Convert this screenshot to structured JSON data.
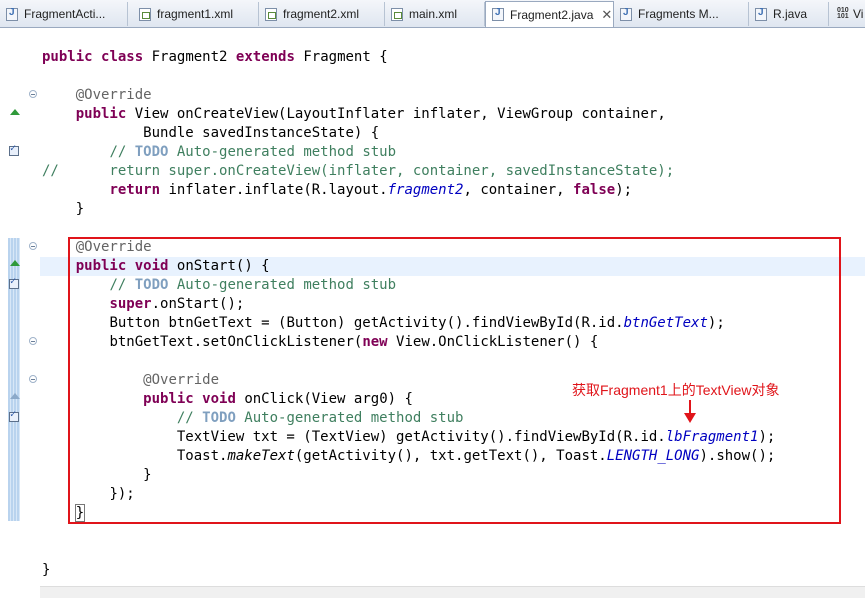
{
  "tabs": [
    {
      "label": "FragmentActi...",
      "icon": "java-file-icon",
      "active": false
    },
    {
      "label": "fragment1.xml",
      "icon": "xml-file-icon",
      "active": false
    },
    {
      "label": "fragment2.xml",
      "icon": "xml-file-icon",
      "active": false
    },
    {
      "label": "main.xml",
      "icon": "xml-file-icon",
      "active": false
    },
    {
      "label": "Fragment2.java",
      "icon": "java-file-icon",
      "active": true,
      "close": "✕"
    },
    {
      "label": "Fragments M...",
      "icon": "java-file-icon",
      "active": false
    },
    {
      "label": "R.java",
      "icon": "java-file-icon",
      "active": false
    },
    {
      "label": "Vi",
      "icon": "binary-file-icon",
      "active": false
    }
  ],
  "code": {
    "l1": [
      "public",
      "class",
      "Fragment2",
      "extends",
      "Fragment {"
    ],
    "override": "@Override",
    "l2": [
      "public",
      "View onCreateView(LayoutInflater inflater, ViewGroup container,"
    ],
    "l3": "Bundle savedInstanceState) {",
    "comment_prefix": "// ",
    "todo": "TODO",
    "todo_text": " Auto-generated method stub",
    "l5": "//      return super.onCreateView(inflater, container, savedInstanceState);",
    "l6": [
      "return",
      "inflater.inflate(R.layout.",
      "fragment2",
      ", container, ",
      "false",
      ");"
    ],
    "close_brace": "}",
    "l8": [
      "public",
      "void",
      "onStart() {"
    ],
    "l10": [
      "super",
      ".onStart();"
    ],
    "l11": [
      "Button btnGetText = (Button) getActivity().findViewById(R.id.",
      "btnGetText",
      ");"
    ],
    "l12": [
      "btnGetText.setOnClickListener(",
      "new",
      " View.OnClickListener() {"
    ],
    "l14": [
      "public",
      "void",
      "onClick(View arg0) {"
    ],
    "l16": [
      "TextView txt = (TextView) getActivity().findViewById(R.id.",
      "lbFragment1",
      ");"
    ],
    "l17": [
      "Toast.",
      "makeText",
      "(getActivity(), txt.getText(), Toast.",
      "LENGTH_LONG",
      ").show();"
    ],
    "l19": "});"
  },
  "annotation": {
    "note": "获取Fragment1上的TextView对象",
    "color": "#e0141a"
  },
  "colors": {
    "keyword": "#7f0055",
    "comment": "#3f7f5f",
    "todo": "#7f9fbf",
    "field": "#0000c0",
    "annotation": "#646464"
  }
}
